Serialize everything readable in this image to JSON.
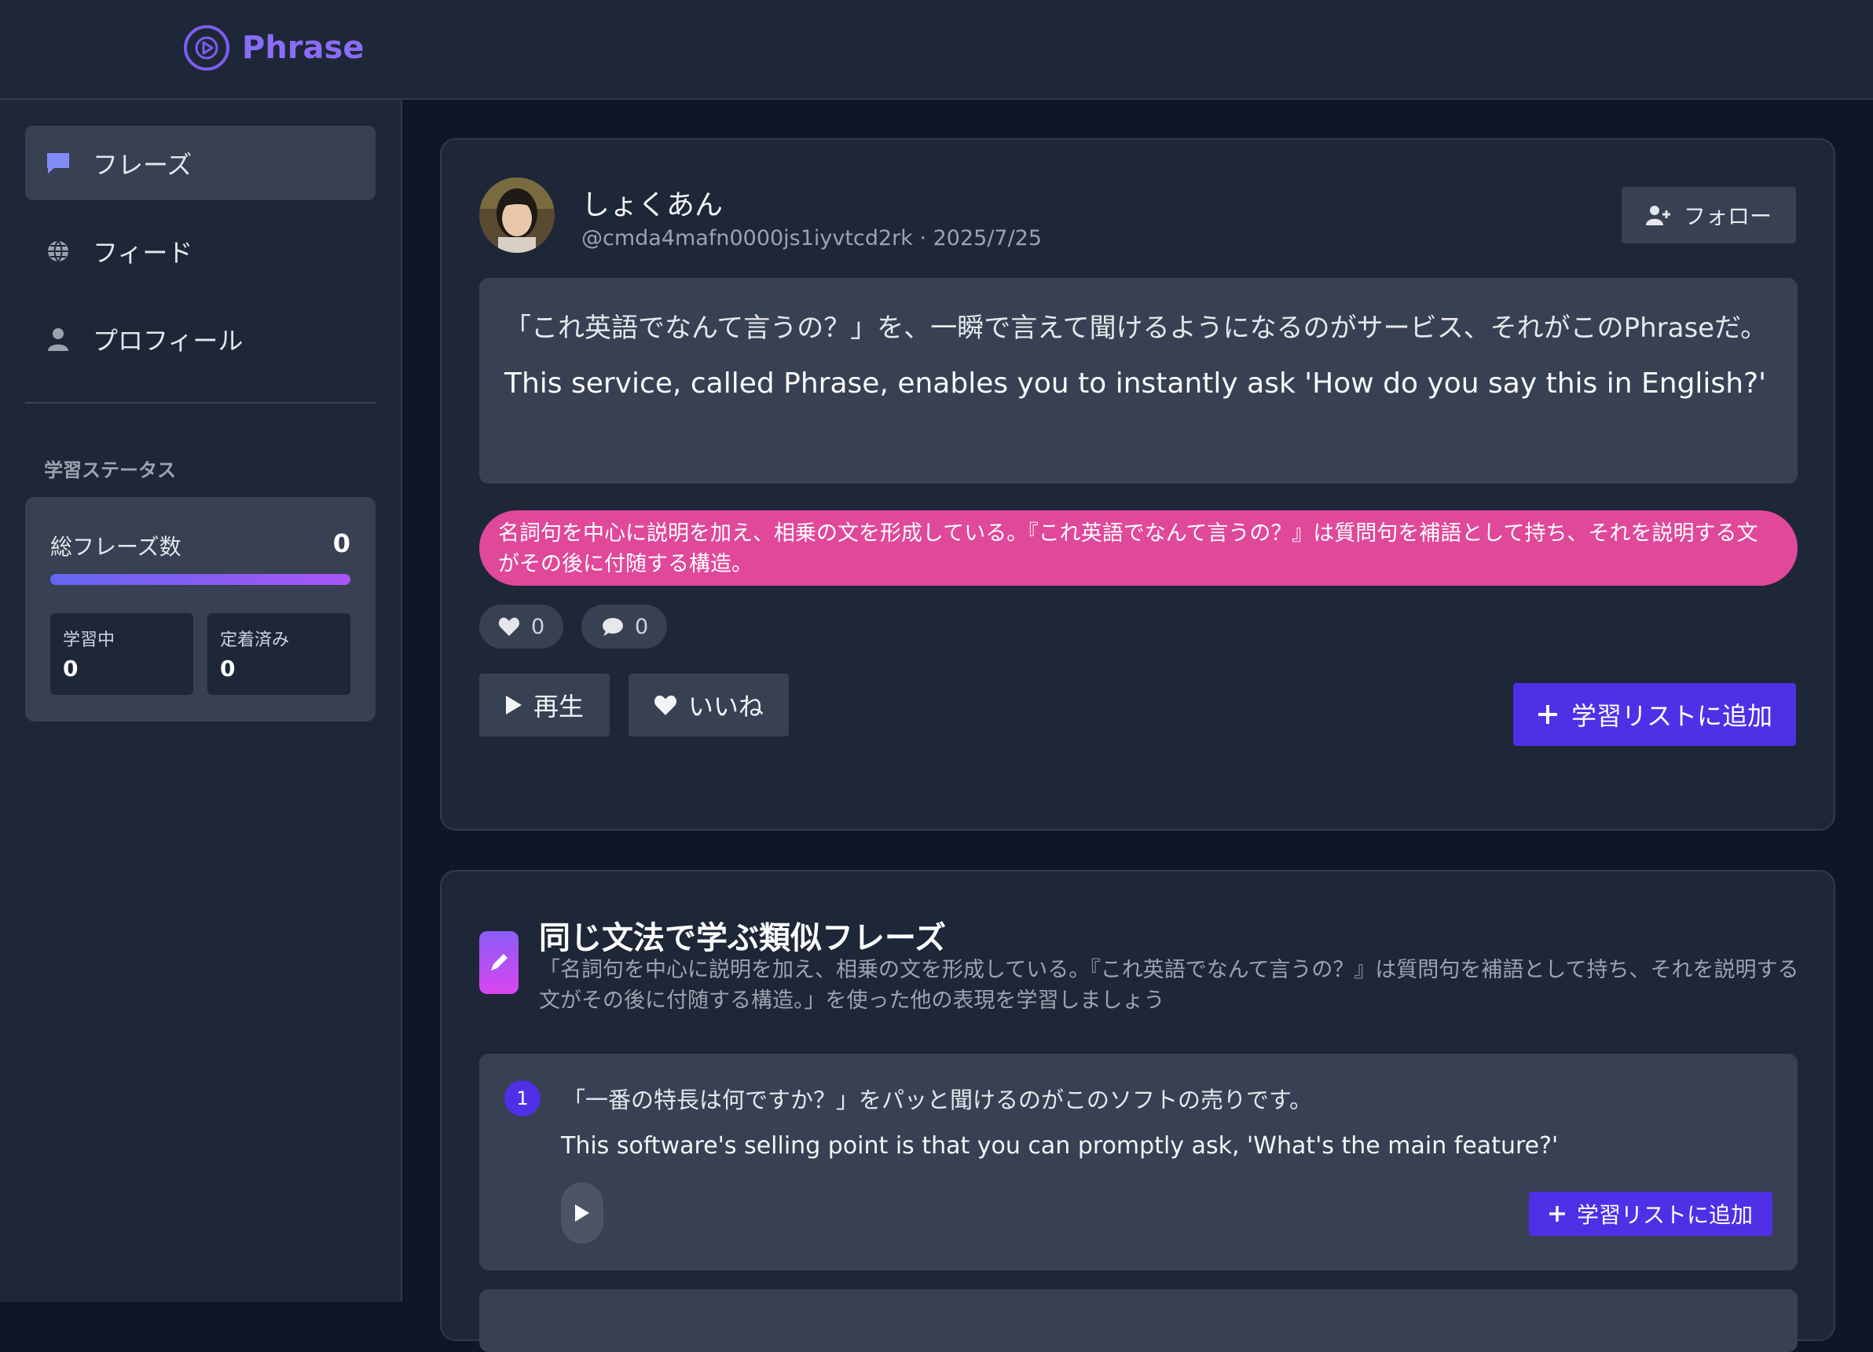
{
  "app": {
    "name": "Phrase"
  },
  "sidebar": {
    "items": [
      {
        "label": "フレーズ",
        "icon": "chat-bubble-icon",
        "active": true
      },
      {
        "label": "フィード",
        "icon": "globe-icon",
        "active": false
      },
      {
        "label": "プロフィール",
        "icon": "user-icon",
        "active": false
      }
    ],
    "section_label": "学習ステータス",
    "stats": {
      "total_label": "総フレーズ数",
      "total_value": "0",
      "learning_label": "学習中",
      "learning_value": "0",
      "mastered_label": "定着済み",
      "mastered_value": "0"
    }
  },
  "post": {
    "username": "しょくあん",
    "handle_date": "@cmda4mafn0000js1iyvtcd2rk · 2025/7/25",
    "follow_label": "フォロー",
    "phrase_ja": "「これ英語でなんて言うの？」を、一瞬で言えて聞けるようになるのがサービス、それがこのPhraseだ。",
    "phrase_en": "This service, called Phrase, enables you to instantly ask 'How do you say this in English?'",
    "grammar": "名詞句を中心に説明を加え、相乗の文を形成している。『これ英語でなんて言うの？』は質問句を補語として持ち、それを説明する文がその後に付随する構造。",
    "likes": "0",
    "comments": "0",
    "play_label": "再生",
    "like_label": "いいね",
    "add_label": "学習リストに追加"
  },
  "similar": {
    "title": "同じ文法で学ぶ類似フレーズ",
    "description": "「名詞句を中心に説明を加え、相乗の文を形成している。『これ英語でなんて言うの？』は質問句を補語として持ち、それを説明する文がその後に付随する構造。」を使った他の表現を学習しましょう",
    "items": [
      {
        "number": "1",
        "ja": "「一番の特長は何ですか？」をパッと聞けるのがこのソフトの売りです。",
        "en": "This software's selling point is that you can promptly ask, 'What's the main feature?'",
        "add_label": "学習リストに追加"
      }
    ]
  },
  "colors": {
    "accent": "#4f30e6",
    "brand": "#8b6cf6",
    "grammar_pill": "#e0489a"
  }
}
